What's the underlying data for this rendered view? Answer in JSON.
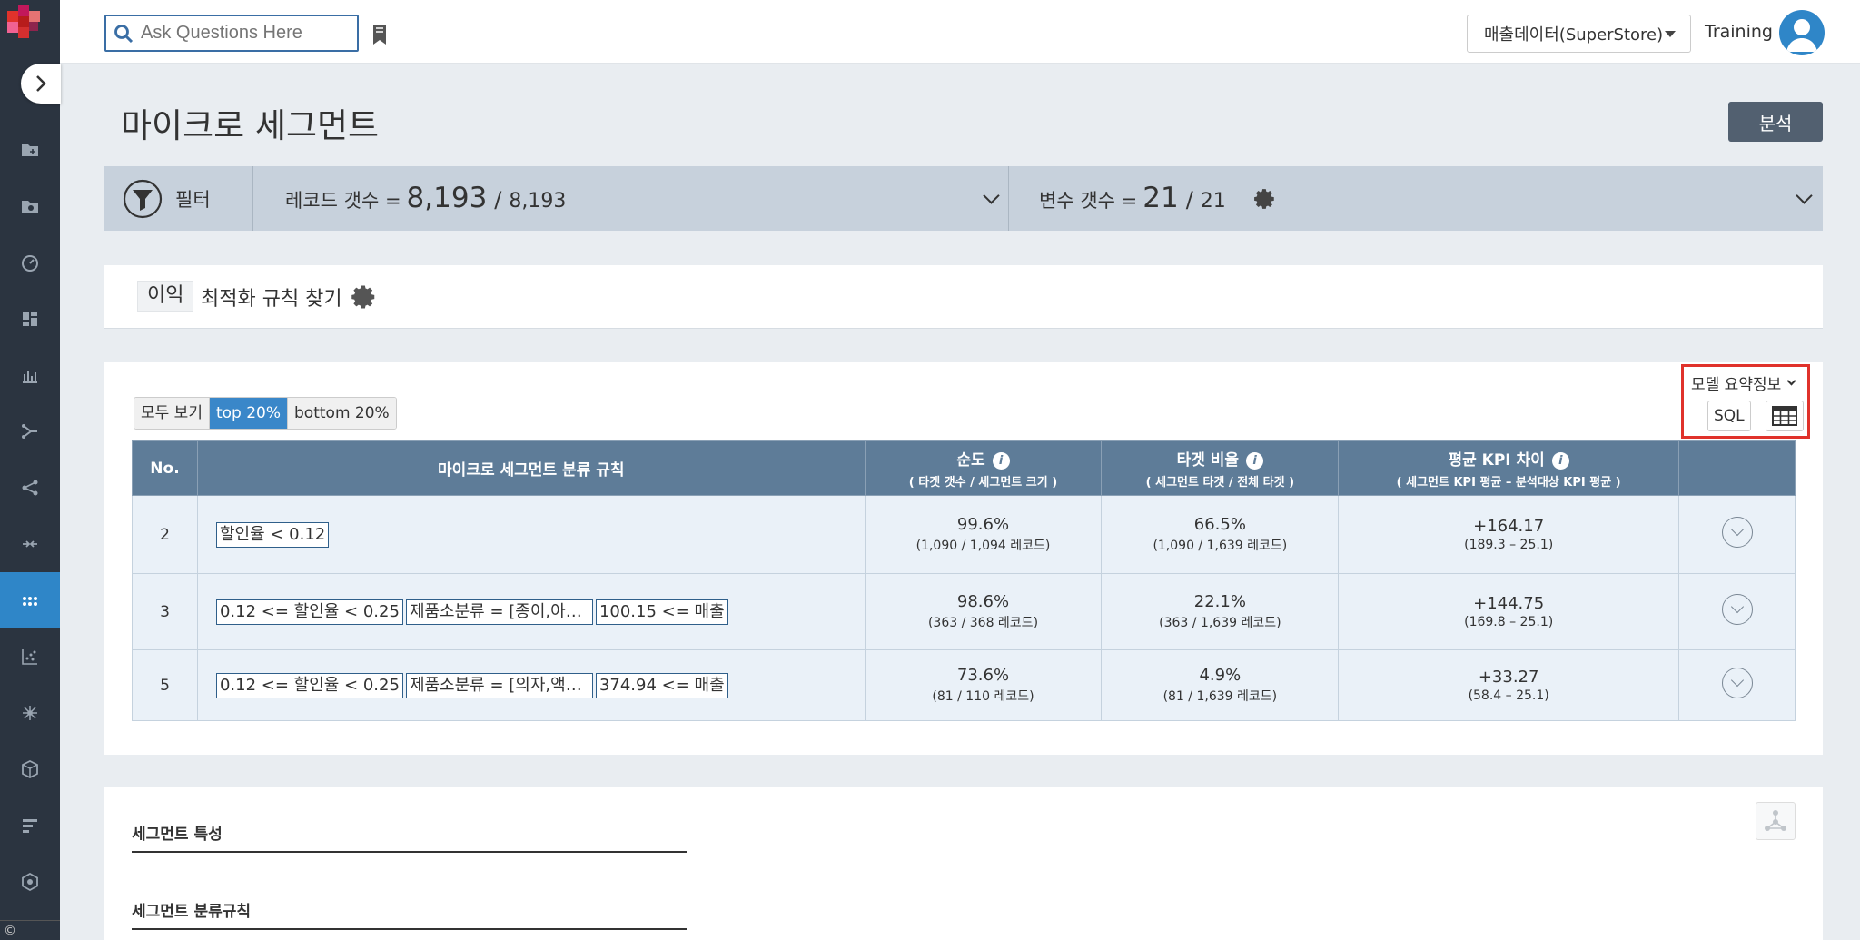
{
  "topbar": {
    "search_placeholder": "Ask Questions Here",
    "dataset": "매출데이터(SuperStore)",
    "user": "Training"
  },
  "page": {
    "title": "마이크로 세그먼트",
    "analyze_label": "분석"
  },
  "filter_bar": {
    "filter_label": "필터",
    "records_label": "레코드 갯수 =",
    "records_selected": "8,193",
    "records_total": "8,193",
    "vars_label": "변수 갯수 =",
    "vars_selected": "21",
    "vars_total": "21",
    "sep": "/"
  },
  "rule_section": {
    "kpi": "이익",
    "title": "최적화 규칙 찾기"
  },
  "segment_view": {
    "buttons": [
      "모두 보기",
      "top 20%",
      "bottom 20%"
    ],
    "active": "top 20%",
    "model_summary_label": "모델 요약정보",
    "sql_label": "SQL"
  },
  "table": {
    "headers": {
      "no": "No.",
      "rule": "마이크로 세그먼트 분류 규칙",
      "purity": "순도",
      "purity_sub": "( 타겟 갯수 / 세그먼트 크기 )",
      "target_ratio": "타겟 비율",
      "target_ratio_sub": "( 세그먼트 타겟 / 전체 타겟 )",
      "kpi_diff": "평균 KPI 차이",
      "kpi_diff_sub": "( 세그먼트 KPI 평균 – 분석대상 KPI 평균 )"
    },
    "rows": [
      {
        "no": "2",
        "conditions": [
          "할인율 < 0.12"
        ],
        "purity": "99.6%",
        "purity_sub": "(1,090 / 1,094 레코드)",
        "target_ratio": "66.5%",
        "target_ratio_sub": "(1,090 / 1,639 레코드)",
        "kpi_diff": "+164.17",
        "kpi_diff_sub": "(189.3 – 25.1)"
      },
      {
        "no": "3",
        "conditions": [
          "0.12 <= 할인율 < 0.25",
          "제품소분류 = [종이,아트…",
          "100.15 <= 매출"
        ],
        "purity": "98.6%",
        "purity_sub": "(363 / 368 레코드)",
        "target_ratio": "22.1%",
        "target_ratio_sub": "(363 / 1,639 레코드)",
        "kpi_diff": "+144.75",
        "kpi_diff_sub": "(169.8 – 25.1)"
      },
      {
        "no": "5",
        "conditions": [
          "0.12 <= 할인율 < 0.25",
          "제품소분류 = [의자,액세…",
          "374.94 <= 매출"
        ],
        "purity": "73.6%",
        "purity_sub": "(81 / 110 레코드)",
        "target_ratio": "4.9%",
        "target_ratio_sub": "(81 / 1,639 레코드)",
        "kpi_diff": "+33.27",
        "kpi_diff_sub": "(58.4 – 25.1)"
      }
    ]
  },
  "segment_detail": {
    "features_label": "세그먼트 특성",
    "rules_label": "세그먼트 분류규칙"
  },
  "sidebar": {
    "copyright": "©"
  },
  "colors": {
    "sidebar_bg": "#2b3440",
    "accent": "#2f86c8",
    "table_header": "#5e7c98",
    "highlight_border": "#e0322b"
  }
}
